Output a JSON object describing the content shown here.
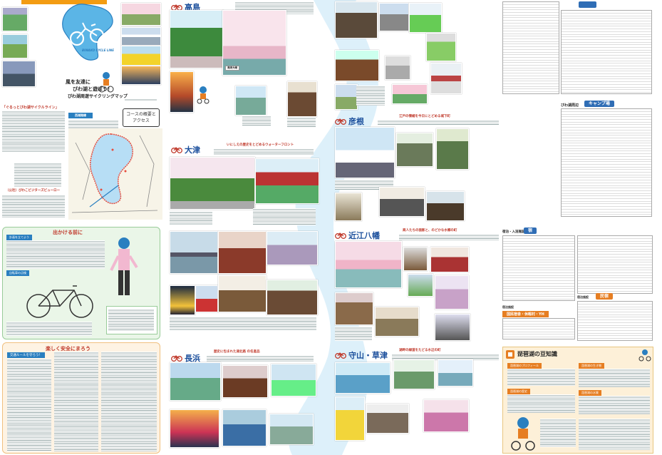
{
  "cover": {
    "map_logo_text": "BIWAKO CYCLE LINE",
    "slogan_line1": "風を友達に",
    "slogan_line2": "びわ湖と遊ぼう！",
    "title": "びわ湖周遊サイクリングマップ",
    "intro_heading": "「ぐるっとびわ湖サイクルライン」",
    "course_box": "コースの概要と\nアクセス",
    "contact_title": "（公社）びわこビジターズビューロー"
  },
  "prep": {
    "heading": "出かける前に"
  },
  "safety": {
    "heading": "楽しく安全にまろう",
    "subheading": "交通ルールを守ろう！"
  },
  "areas": [
    {
      "name": "高島"
    },
    {
      "name": "大津",
      "tagline": "いにしえの歴史をとどめるウォーターフロント"
    },
    {
      "name": "彦根",
      "tagline": "江戸の情緒を今日にとどめる城下町"
    },
    {
      "name": "近江八幡",
      "tagline": "商人たちの面影と、のどかな水郷の町"
    },
    {
      "name": "長浜",
      "tagline": "歴史に包まれた湖北路 の名産品"
    },
    {
      "name": "守山・草津",
      "tagline": "湖畔の緑道をたどる水辺の町"
    }
  ],
  "lists": {
    "camp_heading": "キャンプ場",
    "camp_region": "びわ湖周辺",
    "inn_heading": "宿",
    "inn_sub": "国民宿舎・休暇村・YH",
    "inn_region": "宿泊・入浴施設",
    "hot_heading": "民宿",
    "hot_region": "宿泊施設"
  },
  "trivia": {
    "heading": "琵琶湖の豆知識",
    "items": [
      "琵琶湖のプロフィール",
      "琵琶湖の歴史",
      "琵琶湖の生き物",
      "琵琶湖の水質"
    ]
  },
  "colors": {
    "lake_blue": "#5bb5e6",
    "accent_red": "#c0392b",
    "heading_blue": "#1b4f9c"
  }
}
